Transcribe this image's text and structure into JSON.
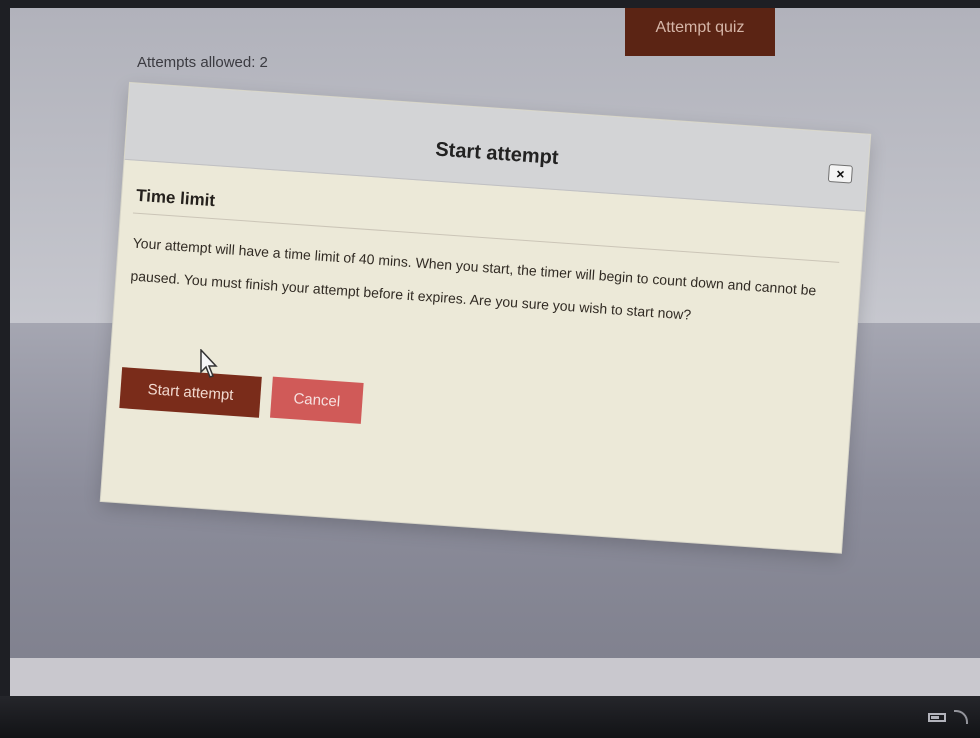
{
  "page": {
    "attempts_text": "Attempts allowed: 2",
    "attempt_quiz_label": "Attempt quiz"
  },
  "dialog": {
    "title": "Start attempt",
    "close_label": "×",
    "section_title": "Time limit",
    "message": "Your attempt will have a time limit of 40 mins. When you start, the timer will begin to count down and cannot be paused. You must finish your attempt before it expires. Are you sure you wish to start now?",
    "start_button": "Start attempt",
    "cancel_button": "Cancel"
  },
  "icons": {
    "cursor": "arrow-cursor-icon",
    "battery": "battery-icon",
    "wifi": "wifi-icon"
  },
  "colors": {
    "start_button": "#7a2c1a",
    "cancel_button": "#d05a58",
    "attempt_quiz_button": "#5b2414"
  }
}
